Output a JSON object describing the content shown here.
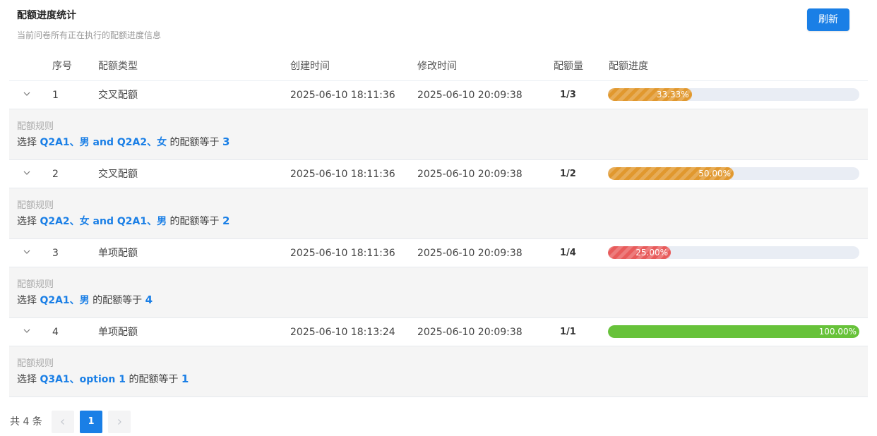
{
  "header": {
    "title": "配额进度统计",
    "subtitle": "当前问卷所有正在执行的配额进度信息",
    "refresh_label": "刷新"
  },
  "columns": {
    "index": "序号",
    "type": "配额类型",
    "created": "创建时间",
    "modified": "修改时间",
    "quantity": "配额量",
    "progress": "配额进度"
  },
  "rows": [
    {
      "index": "1",
      "type": "交叉配额",
      "created": "2025-06-10 18:11:36",
      "modified": "2025-06-10 20:09:38",
      "quantity": "1/3",
      "progress_value": 33.33,
      "progress_label": "33.33%",
      "color": "#e1982e",
      "striped": true,
      "rule_label": "配额规则",
      "rule_prefix": "选择",
      "rule_condition": "Q2A1、男 and Q2A2、女",
      "rule_suffix": "的配额等于",
      "rule_count": "3"
    },
    {
      "index": "2",
      "type": "交叉配额",
      "created": "2025-06-10 18:11:36",
      "modified": "2025-06-10 20:09:38",
      "quantity": "1/2",
      "progress_value": 50.0,
      "progress_label": "50.00%",
      "color": "#e1982e",
      "striped": true,
      "rule_label": "配额规则",
      "rule_prefix": "选择",
      "rule_condition": "Q2A2、女 and Q2A1、男",
      "rule_suffix": "的配额等于",
      "rule_count": "2"
    },
    {
      "index": "3",
      "type": "单项配额",
      "created": "2025-06-10 18:11:36",
      "modified": "2025-06-10 20:09:38",
      "quantity": "1/4",
      "progress_value": 25.0,
      "progress_label": "25.00%",
      "color": "#e85b5b",
      "striped": true,
      "rule_label": "配额规则",
      "rule_prefix": "选择",
      "rule_condition": "Q2A1、男",
      "rule_suffix": "的配额等于",
      "rule_count": "4"
    },
    {
      "index": "4",
      "type": "单项配额",
      "created": "2025-06-10 18:13:24",
      "modified": "2025-06-10 20:09:38",
      "quantity": "1/1",
      "progress_value": 100.0,
      "progress_label": "100.00%",
      "color": "#67c23a",
      "striped": false,
      "rule_label": "配额规则",
      "rule_prefix": "选择",
      "rule_condition": "Q3A1、option 1",
      "rule_suffix": "的配额等于",
      "rule_count": "1"
    }
  ],
  "pagination": {
    "total_text": "共 4 条",
    "current_page": "1",
    "prev_icon": "chevron-left-icon",
    "next_icon": "chevron-right-icon"
  },
  "icons": {
    "expand": "chevron-down-icon"
  },
  "colors": {
    "accent": "#1a7fe6",
    "track": "#e9edf4",
    "expanded_bg": "#f5f5f5"
  }
}
